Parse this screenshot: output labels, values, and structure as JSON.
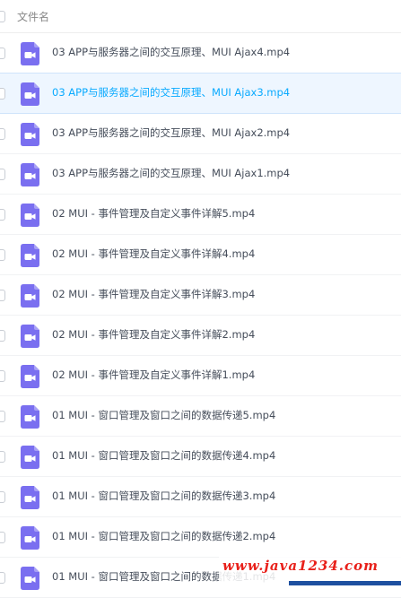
{
  "header": {
    "column_label": "文件名"
  },
  "files": [
    {
      "name": "03 APP与服务器之间的交互原理、MUI Ajax4.mp4",
      "selected": false
    },
    {
      "name": "03 APP与服务器之间的交互原理、MUI Ajax3.mp4",
      "selected": true
    },
    {
      "name": "03 APP与服务器之间的交互原理、MUI Ajax2.mp4",
      "selected": false
    },
    {
      "name": "03 APP与服务器之间的交互原理、MUI Ajax1.mp4",
      "selected": false
    },
    {
      "name": "02 MUI - 事件管理及自定义事件详解5.mp4",
      "selected": false
    },
    {
      "name": "02 MUI - 事件管理及自定义事件详解4.mp4",
      "selected": false
    },
    {
      "name": "02 MUI - 事件管理及自定义事件详解3.mp4",
      "selected": false
    },
    {
      "name": "02 MUI - 事件管理及自定义事件详解2.mp4",
      "selected": false
    },
    {
      "name": "02 MUI - 事件管理及自定义事件详解1.mp4",
      "selected": false
    },
    {
      "name": "01 MUI - 窗口管理及窗口之间的数据传递5.mp4",
      "selected": false
    },
    {
      "name": "01 MUI - 窗口管理及窗口之间的数据传递4.mp4",
      "selected": false
    },
    {
      "name": "01 MUI - 窗口管理及窗口之间的数据传递3.mp4",
      "selected": false
    },
    {
      "name": "01 MUI - 窗口管理及窗口之间的数据传递2.mp4",
      "selected": false
    },
    {
      "name": "01 MUI - 窗口管理及窗口之间的数据传递1.mp4",
      "selected": false
    }
  ],
  "watermark": {
    "text": "www.java1234.com"
  },
  "icons": {
    "file": "video-file-icon"
  },
  "colors": {
    "video_icon": "#7a6ff0",
    "selected_text": "#09aaff",
    "selected_bg": "#eef6ff",
    "watermark_text": "#e8201a",
    "watermark_bar": "#1e50a0"
  }
}
